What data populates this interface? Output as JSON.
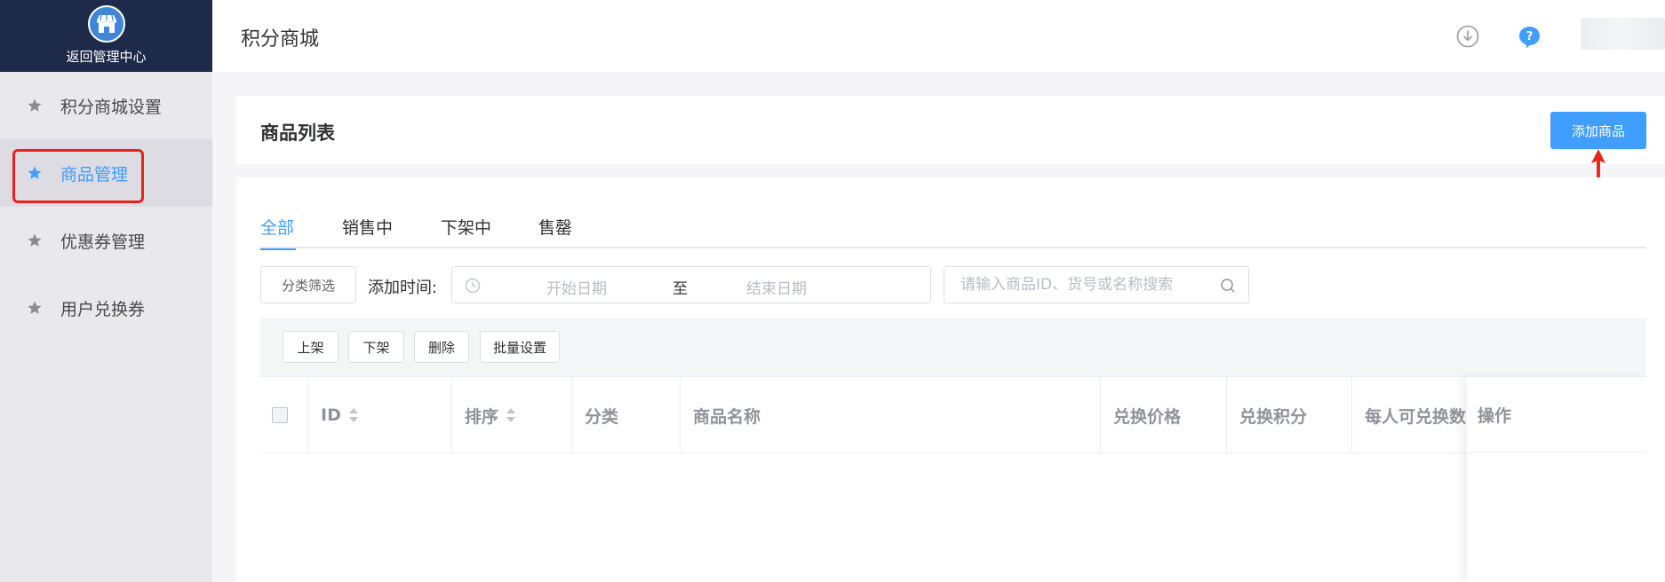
{
  "sidebar": {
    "back_label": "返回管理中心",
    "items": [
      {
        "label": "积分商城设置"
      },
      {
        "label": "商品管理"
      },
      {
        "label": "优惠券管理"
      },
      {
        "label": "用户兑换券"
      }
    ]
  },
  "header": {
    "title": "积分商城"
  },
  "product_list": {
    "title": "商品列表",
    "add_button": "添加商品"
  },
  "tabs": [
    {
      "label": "全部"
    },
    {
      "label": "销售中"
    },
    {
      "label": "下架中"
    },
    {
      "label": "售罄"
    }
  ],
  "filters": {
    "category_button": "分类筛选",
    "time_label": "添加时间:",
    "start_placeholder": "开始日期",
    "separator": "至",
    "end_placeholder": "结束日期",
    "search_placeholder": "请输入商品ID、货号或名称搜索"
  },
  "actions": [
    {
      "label": "上架"
    },
    {
      "label": "下架"
    },
    {
      "label": "删除"
    },
    {
      "label": "批量设置"
    }
  ],
  "table": {
    "columns": [
      "ID",
      "排序",
      "分类",
      "商品名称",
      "兑换价格",
      "兑换积分",
      "每人可兑换数",
      "操作"
    ]
  },
  "colors": {
    "accent": "#409eff",
    "sidebar_top": "#1e2a4a",
    "annotation": "#e8231c"
  }
}
